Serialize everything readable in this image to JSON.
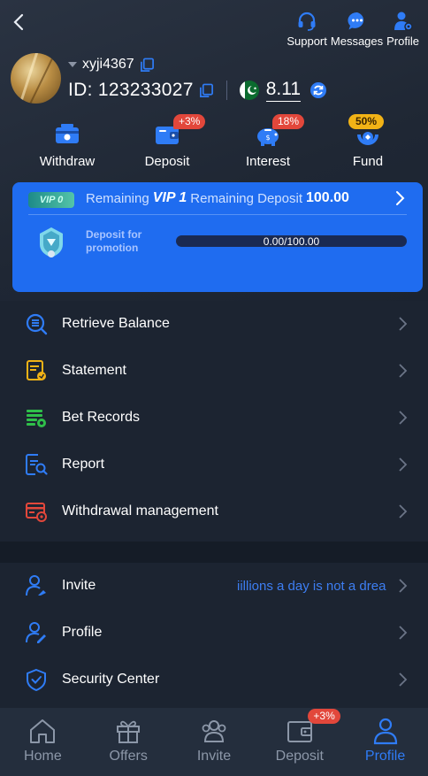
{
  "header": {
    "top_actions": [
      {
        "label": "Support",
        "icon": "headset-icon"
      },
      {
        "label": "Messages",
        "icon": "chat-bubble-icon"
      },
      {
        "label": "Profile",
        "icon": "user-gear-icon"
      }
    ],
    "username": "xyji4367",
    "id_text": "ID: 123233027",
    "balance": "8.11",
    "colors": {
      "accent": "#1f6cf0",
      "background": "#1c2431",
      "badge_red": "#e2473b",
      "badge_gold": "#f2b316"
    }
  },
  "quick_actions": [
    {
      "label": "Withdraw",
      "icon": "withdraw-icon",
      "badge": ""
    },
    {
      "label": "Deposit",
      "icon": "wallet-icon",
      "badge": "+3%"
    },
    {
      "label": "Interest",
      "icon": "piggy-bank-icon",
      "badge": "18%"
    },
    {
      "label": "Fund",
      "icon": "fund-icon",
      "badge": "50%"
    }
  ],
  "vip": {
    "badge": "VIP 0",
    "remaining_label": "Remaining",
    "next_level": "VIP 1",
    "remaining_deposit_label": "Remaining Deposit",
    "remaining_deposit": "100.00",
    "promo_label": "Deposit for promotion",
    "progress_text": "0.00/100.00",
    "progress_fraction": 0.0
  },
  "menu_primary": [
    {
      "label": "Retrieve Balance",
      "icon": "retrieve-balance-icon",
      "color": "#2f7cf6"
    },
    {
      "label": "Statement",
      "icon": "statement-icon",
      "color": "#f2b316"
    },
    {
      "label": "Bet Records",
      "icon": "bet-records-icon",
      "color": "#2fbf4a"
    },
    {
      "label": "Report",
      "icon": "report-icon",
      "color": "#2f7cf6"
    },
    {
      "label": "Withdrawal management",
      "icon": "withdrawal-management-icon",
      "color": "#e2473b"
    }
  ],
  "menu_secondary": [
    {
      "label": "Invite",
      "icon": "invite-icon",
      "marquee": "iillions a day is not a drea"
    },
    {
      "label": "Profile",
      "icon": "profile-edit-icon"
    },
    {
      "label": "Security Center",
      "icon": "security-shield-icon"
    }
  ],
  "bottom_nav": [
    {
      "label": "Home",
      "icon": "home-icon",
      "active": false,
      "badge": ""
    },
    {
      "label": "Offers",
      "icon": "gift-icon",
      "active": false,
      "badge": ""
    },
    {
      "label": "Invite",
      "icon": "people-icon",
      "active": false,
      "badge": ""
    },
    {
      "label": "Deposit",
      "icon": "deposit-wallet-icon",
      "active": false,
      "badge": "+3%"
    },
    {
      "label": "Profile",
      "icon": "person-icon",
      "active": true,
      "badge": ""
    }
  ]
}
